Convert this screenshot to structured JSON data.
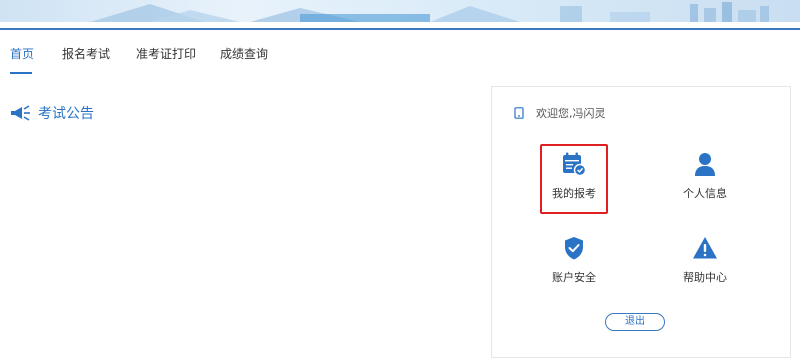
{
  "nav": {
    "tabs": [
      {
        "label": "首页",
        "active": true
      },
      {
        "label": "报名考试",
        "active": false
      },
      {
        "label": "准考证打印",
        "active": false
      },
      {
        "label": "成绩查询",
        "active": false
      }
    ]
  },
  "announcement": {
    "title": "考试公告",
    "icon": "megaphone-icon"
  },
  "user_panel": {
    "welcome": "欢迎您,冯闪灵",
    "welcome_icon": "phone-icon",
    "items": [
      {
        "label": "我的报考",
        "icon": "calendar-check-icon",
        "highlighted": true
      },
      {
        "label": "个人信息",
        "icon": "user-icon",
        "highlighted": false
      },
      {
        "label": "账户安全",
        "icon": "shield-check-icon",
        "highlighted": false
      },
      {
        "label": "帮助中心",
        "icon": "warning-icon",
        "highlighted": false
      }
    ],
    "logout": "退出"
  },
  "colors": {
    "accent": "#2a73c5",
    "highlight_border": "#e02020",
    "panel_border": "#e3e7ec"
  }
}
